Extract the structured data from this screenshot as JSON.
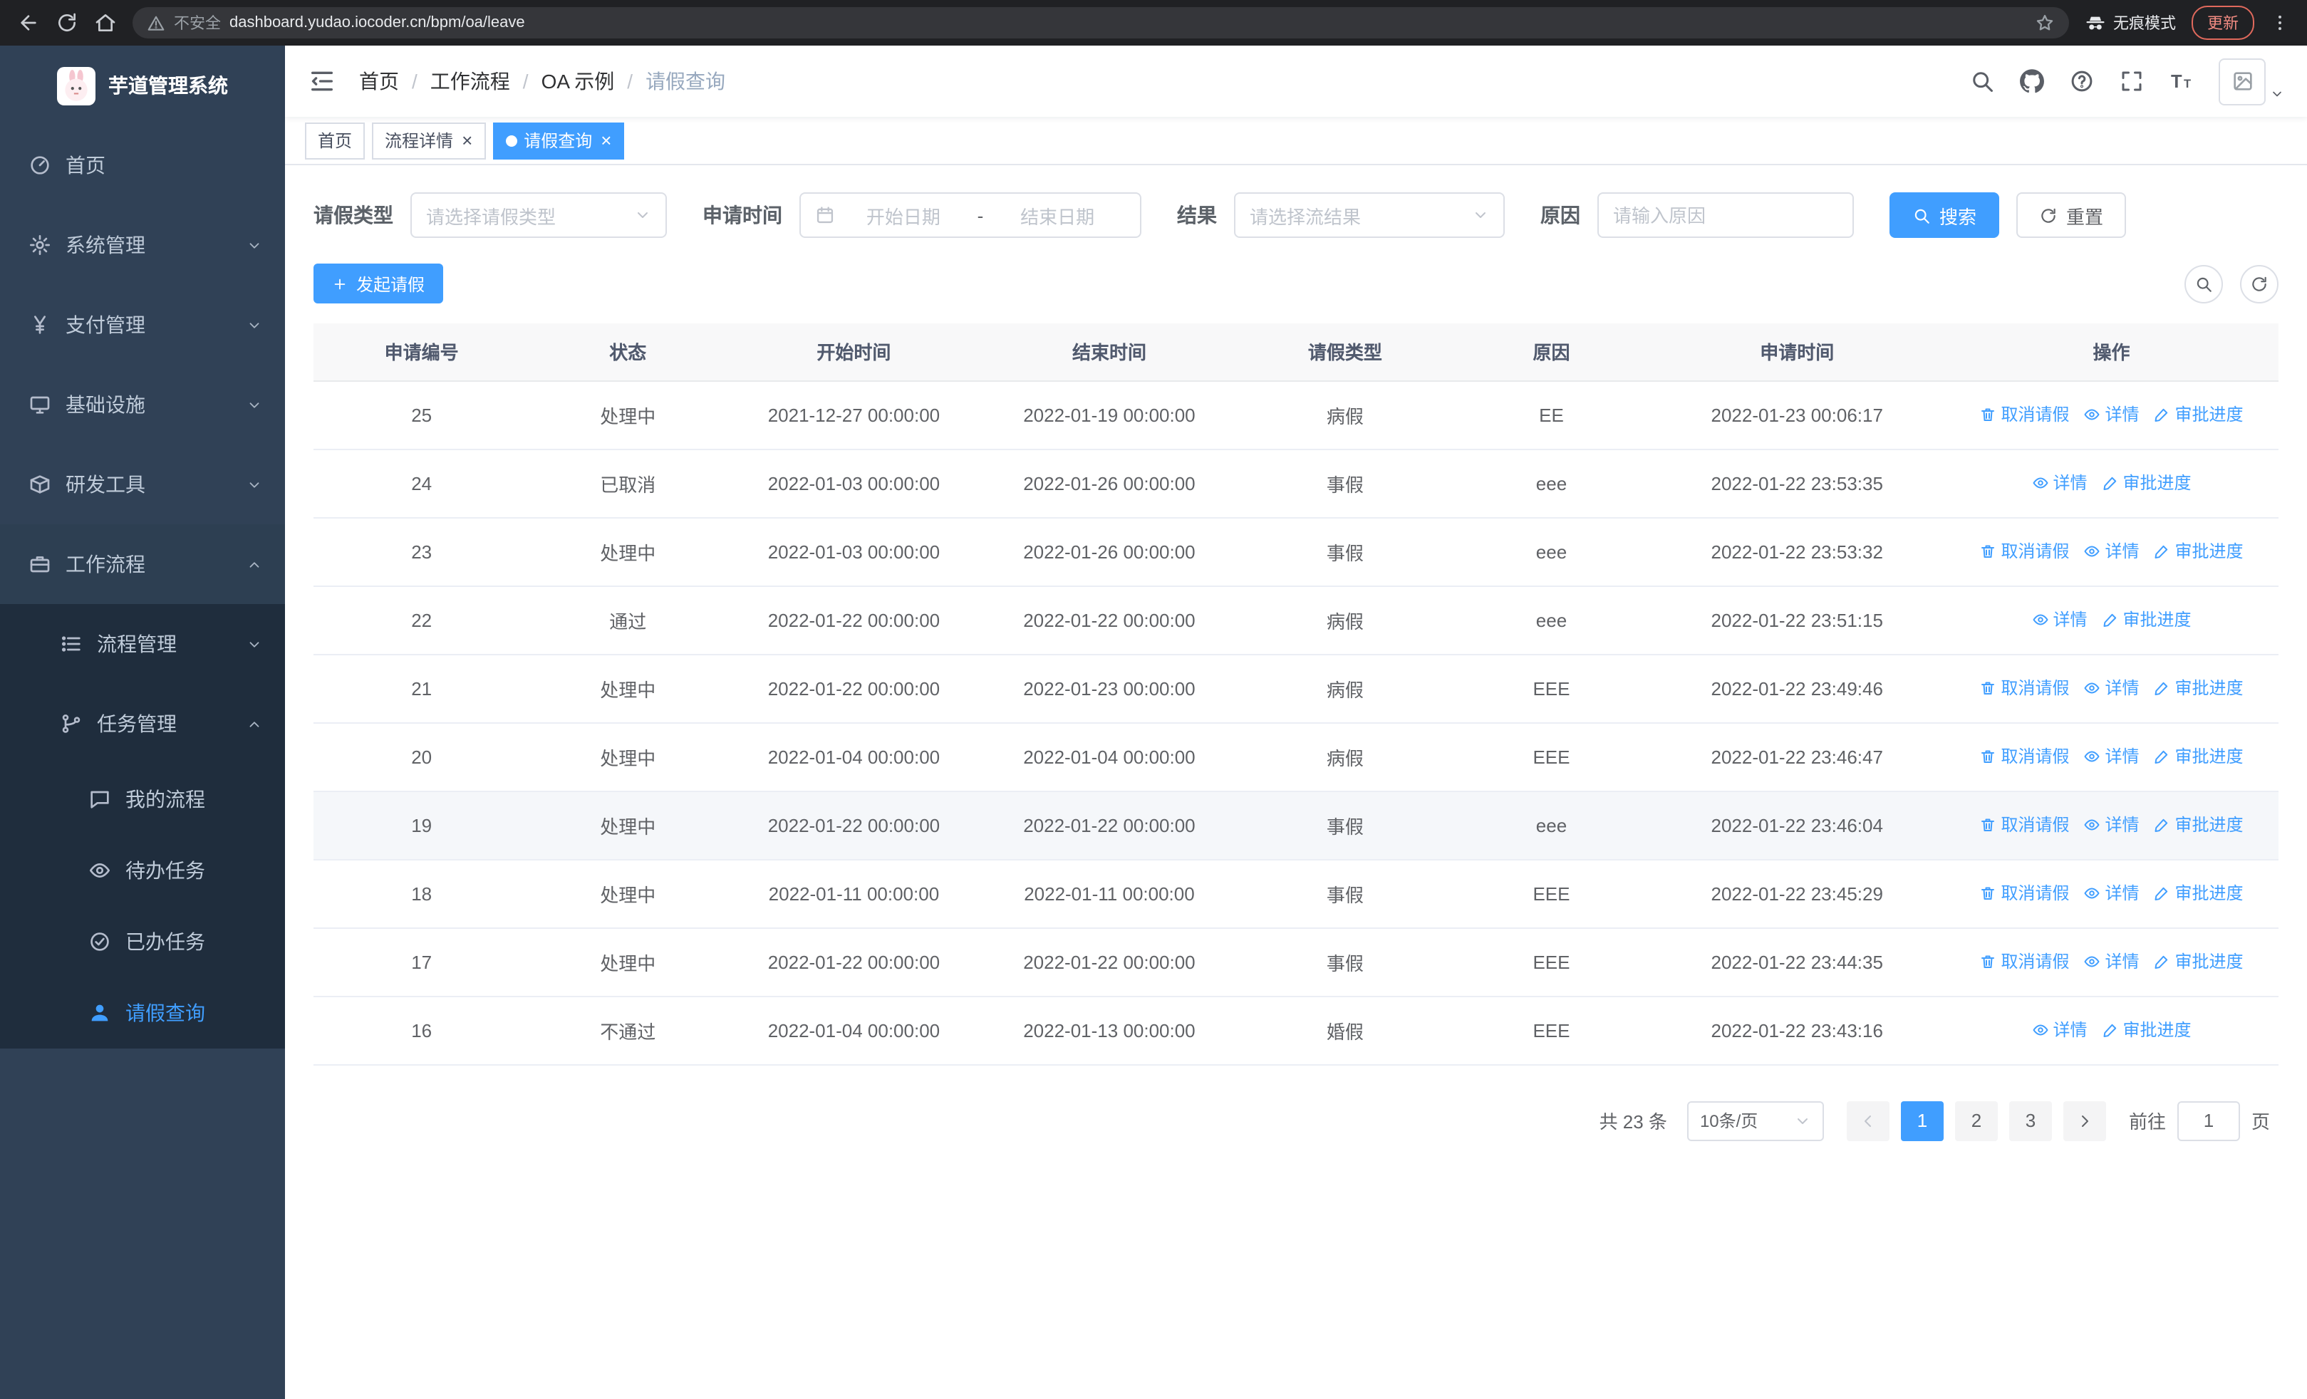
{
  "browser": {
    "url": "dashboard.yudao.iocoder.cn/bpm/oa/leave",
    "security_label": "不安全",
    "incognito_label": "无痕模式",
    "update_label": "更新"
  },
  "sidebar": {
    "logo_title": "芋道管理系统",
    "items": [
      {
        "key": "home",
        "label": "首页",
        "icon": "gauge",
        "level": 1
      },
      {
        "key": "system",
        "label": "系统管理",
        "icon": "gear",
        "level": 1,
        "chevron": "down"
      },
      {
        "key": "payment",
        "label": "支付管理",
        "icon": "yen",
        "level": 1,
        "chevron": "down"
      },
      {
        "key": "infrastructure",
        "label": "基础设施",
        "icon": "monitor",
        "level": 1,
        "chevron": "down"
      },
      {
        "key": "devtools",
        "label": "研发工具",
        "icon": "box",
        "level": 1,
        "chevron": "down"
      },
      {
        "key": "workflow",
        "label": "工作流程",
        "icon": "briefcase",
        "level": 1,
        "chevron": "up",
        "expanded": true
      },
      {
        "key": "process-management",
        "label": "流程管理",
        "icon": "list",
        "level": 2,
        "chevron": "down"
      },
      {
        "key": "task-management",
        "label": "任务管理",
        "icon": "branch",
        "level": 2,
        "chevron": "up",
        "expanded": true
      },
      {
        "key": "my-process",
        "label": "我的流程",
        "icon": "chat",
        "level": 3
      },
      {
        "key": "todo-tasks",
        "label": "待办任务",
        "icon": "eye",
        "level": 3
      },
      {
        "key": "done-tasks",
        "label": "已办任务",
        "icon": "check-circle",
        "level": 3
      },
      {
        "key": "leave-query",
        "label": "请假查询",
        "icon": "user",
        "level": 3,
        "active": true
      }
    ]
  },
  "header": {
    "breadcrumb": [
      "首页",
      "工作流程",
      "OA 示例",
      "请假查询"
    ]
  },
  "tabs": [
    {
      "key": "home",
      "label": "首页",
      "closable": false,
      "active": false
    },
    {
      "key": "process-detail",
      "label": "流程详情",
      "closable": true,
      "active": false
    },
    {
      "key": "leave-query",
      "label": "请假查询",
      "closable": true,
      "active": true
    }
  ],
  "filters": {
    "leave_type_label": "请假类型",
    "leave_type_placeholder": "请选择请假类型",
    "apply_time_label": "申请时间",
    "start_date_placeholder": "开始日期",
    "range_separator": "-",
    "end_date_placeholder": "结束日期",
    "result_label": "结果",
    "result_placeholder": "请选择流结果",
    "reason_label": "原因",
    "reason_placeholder": "请输入原因",
    "search_button": "搜索",
    "reset_button": "重置"
  },
  "toolbar": {
    "create_button": "发起请假"
  },
  "table": {
    "columns": [
      "申请编号",
      "状态",
      "开始时间",
      "结束时间",
      "请假类型",
      "原因",
      "申请时间",
      "操作"
    ],
    "action_labels": {
      "cancel": "取消请假",
      "detail": "详情",
      "progress": "审批进度"
    },
    "rows": [
      {
        "id": "25",
        "status": "处理中",
        "start": "2021-12-27 00:00:00",
        "end": "2022-01-19 00:00:00",
        "type": "病假",
        "reason": "EE",
        "applied": "2022-01-23 00:06:17",
        "actions": [
          "cancel",
          "detail",
          "progress"
        ]
      },
      {
        "id": "24",
        "status": "已取消",
        "start": "2022-01-03 00:00:00",
        "end": "2022-01-26 00:00:00",
        "type": "事假",
        "reason": "eee",
        "applied": "2022-01-22 23:53:35",
        "actions": [
          "detail",
          "progress"
        ]
      },
      {
        "id": "23",
        "status": "处理中",
        "start": "2022-01-03 00:00:00",
        "end": "2022-01-26 00:00:00",
        "type": "事假",
        "reason": "eee",
        "applied": "2022-01-22 23:53:32",
        "actions": [
          "cancel",
          "detail",
          "progress"
        ]
      },
      {
        "id": "22",
        "status": "通过",
        "start": "2022-01-22 00:00:00",
        "end": "2022-01-22 00:00:00",
        "type": "病假",
        "reason": "eee",
        "applied": "2022-01-22 23:51:15",
        "actions": [
          "detail",
          "progress"
        ]
      },
      {
        "id": "21",
        "status": "处理中",
        "start": "2022-01-22 00:00:00",
        "end": "2022-01-23 00:00:00",
        "type": "病假",
        "reason": "EEE",
        "applied": "2022-01-22 23:49:46",
        "actions": [
          "cancel",
          "detail",
          "progress"
        ]
      },
      {
        "id": "20",
        "status": "处理中",
        "start": "2022-01-04 00:00:00",
        "end": "2022-01-04 00:00:00",
        "type": "病假",
        "reason": "EEE",
        "applied": "2022-01-22 23:46:47",
        "actions": [
          "cancel",
          "detail",
          "progress"
        ]
      },
      {
        "id": "19",
        "status": "处理中",
        "start": "2022-01-22 00:00:00",
        "end": "2022-01-22 00:00:00",
        "type": "事假",
        "reason": "eee",
        "applied": "2022-01-22 23:46:04",
        "actions": [
          "cancel",
          "detail",
          "progress"
        ],
        "hover": true
      },
      {
        "id": "18",
        "status": "处理中",
        "start": "2022-01-11 00:00:00",
        "end": "2022-01-11 00:00:00",
        "type": "事假",
        "reason": "EEE",
        "applied": "2022-01-22 23:45:29",
        "actions": [
          "cancel",
          "detail",
          "progress"
        ]
      },
      {
        "id": "17",
        "status": "处理中",
        "start": "2022-01-22 00:00:00",
        "end": "2022-01-22 00:00:00",
        "type": "事假",
        "reason": "EEE",
        "applied": "2022-01-22 23:44:35",
        "actions": [
          "cancel",
          "detail",
          "progress"
        ]
      },
      {
        "id": "16",
        "status": "不通过",
        "start": "2022-01-04 00:00:00",
        "end": "2022-01-13 00:00:00",
        "type": "婚假",
        "reason": "EEE",
        "applied": "2022-01-22 23:43:16",
        "actions": [
          "detail",
          "progress"
        ]
      }
    ]
  },
  "pagination": {
    "total_label": "共 23 条",
    "page_size": "10条/页",
    "pages": [
      "1",
      "2",
      "3"
    ],
    "active_page": "1",
    "goto_label": "前往",
    "goto_value": "1",
    "page_label": "页"
  },
  "colors": {
    "accent": "#409eff",
    "sidebar_bg": "#304156",
    "submenu_bg": "#1f2d3d"
  }
}
